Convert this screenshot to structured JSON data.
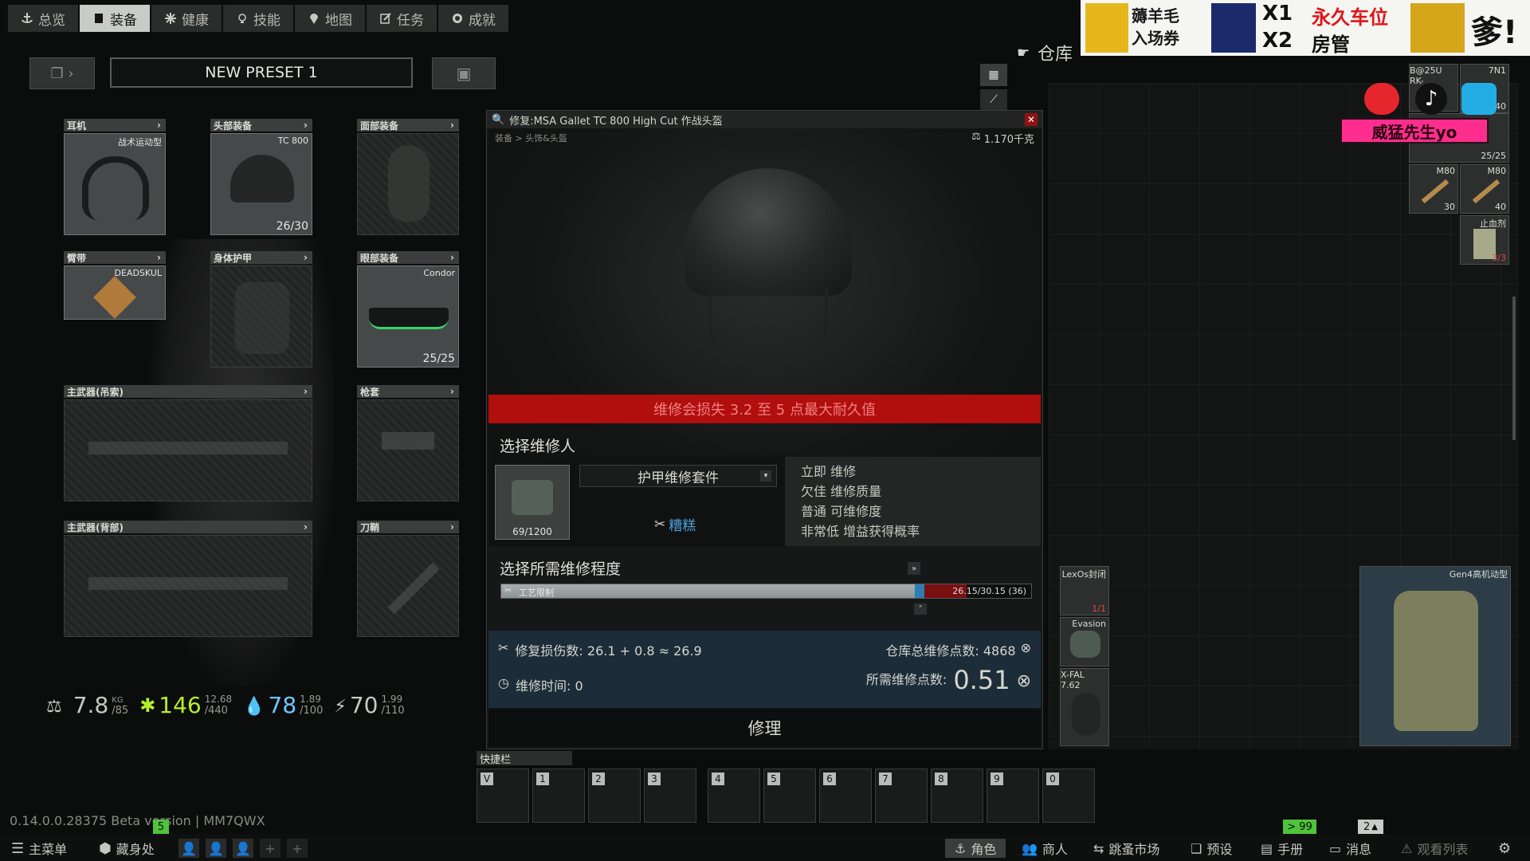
{
  "nav": {
    "tabs": [
      {
        "label": "总览",
        "icon": "anchor-icon"
      },
      {
        "label": "装备",
        "icon": "gear-equipment-icon"
      },
      {
        "label": "健康",
        "icon": "health-icon"
      },
      {
        "label": "技能",
        "icon": "skills-icon"
      },
      {
        "label": "地图",
        "icon": "map-pin-icon"
      },
      {
        "label": "任务",
        "icon": "task-icon"
      },
      {
        "label": "成就",
        "icon": "achievement-icon"
      }
    ],
    "active_index": 1,
    "stash_label": "仓库"
  },
  "preset": {
    "name": "NEW PRESET 1"
  },
  "slots": {
    "earpiece": {
      "label": "耳机",
      "tag": "战术运动型"
    },
    "headwear": {
      "label": "头部装备",
      "tag": "TC 800",
      "count": "26/30"
    },
    "face_cover": {
      "label": "面部装备"
    },
    "armband": {
      "label": "臂带",
      "tag": "DEADSKUL"
    },
    "body_armor": {
      "label": "身体护甲"
    },
    "eyewear": {
      "label": "眼部装备",
      "tag": "Condor",
      "count": "25/25"
    },
    "primary_sling": {
      "label": "主武器(吊索)"
    },
    "holster": {
      "label": "枪套"
    },
    "primary_back": {
      "label": "主武器(背部)"
    },
    "scabbard": {
      "label": "刀鞘"
    }
  },
  "stats": {
    "weight": {
      "value": "7.8",
      "unit": "KG",
      "max": "/85"
    },
    "health": {
      "value": "146",
      "max": "/440",
      "delta": "12.68"
    },
    "hydration": {
      "value": "78",
      "max": "/100",
      "delta": "1.89"
    },
    "energy": {
      "value": "70",
      "max": "/110",
      "delta": "1.99"
    }
  },
  "dialog": {
    "title": "修复:MSA Gallet TC 800 High Cut 作战头盔",
    "breadcrumb": "装备 > 头饰&头盔",
    "weight": "1.170千克",
    "warning": "维修会损失 3.2 至 5 点最大耐久值",
    "select_repairer_title": "选择维修人",
    "kit": {
      "name": "护甲维修套件",
      "count": "69/1200",
      "quality": "糟糕"
    },
    "repairer_info": [
      "立即 维修",
      "欠佳 维修质量",
      "普通 可维修度",
      "非常低 增益获得概率"
    ],
    "select_degree_title": "选择所需维修程度",
    "degree_bar": {
      "label": "工艺限制",
      "value": "26.15/30.15 (36)",
      "fill": 0.78
    },
    "repair_damage": "修复损伤数: 26.1 + 0.8 ≈ 26.9",
    "repair_time": "维修时间: 0",
    "stash_total_points": "仓库总维修点数: 4868",
    "required_points_label": "所需维修点数:",
    "required_points_value": "0.51",
    "repair_button": "修理"
  },
  "stash_items": [
    {
      "name": "B@25U RK-",
      "count": ""
    },
    {
      "name": "7N1",
      "count": "40"
    },
    {
      "name": "",
      "count": "25/25"
    },
    {
      "name": "M80",
      "count": "30"
    },
    {
      "name": "M80",
      "count": "40"
    },
    {
      "name": "止血剂",
      "count": "3/3"
    },
    {
      "name": "LexOs封闭",
      "count": "1/1"
    },
    {
      "name": "Evasion",
      "count": ""
    },
    {
      "name": "X-FAL 7.62",
      "count": ""
    },
    {
      "name": "Gen4高机动型",
      "count": ""
    }
  ],
  "quickbar": {
    "label": "快捷栏",
    "slots": [
      "V",
      "1",
      "2",
      "3",
      "4",
      "5",
      "6",
      "7",
      "8",
      "9",
      "0"
    ]
  },
  "bottom": {
    "version": "0.14.0.0.28375 Beta version | MM7QWX",
    "main_menu": "主菜单",
    "hideout": "藏身处",
    "character": "角色",
    "traders": "商人",
    "flea_market": "跳蚤市场",
    "presets": "预设",
    "handbook": "手册",
    "messages": "消息",
    "watchlist": "观看列表",
    "badge_left": "5",
    "badge_right": "> 99",
    "badge_group": "2"
  },
  "overlay": {
    "banner_text_1": "薅羊毛入场券",
    "banner_text_2": "X1",
    "banner_text_3": "永久车位",
    "banner_text_4": "X2",
    "banner_text_5": "房管",
    "banner_text_6": "爹!",
    "streamer_name": "威猛先生yo"
  },
  "colors": {
    "warning_red": "#b10e0e",
    "quality_blue": "#4fa1d8",
    "summary_bg": "#1c2d39",
    "streamer_pink": "#ff2e8e",
    "badge_green": "#4fc43b"
  }
}
